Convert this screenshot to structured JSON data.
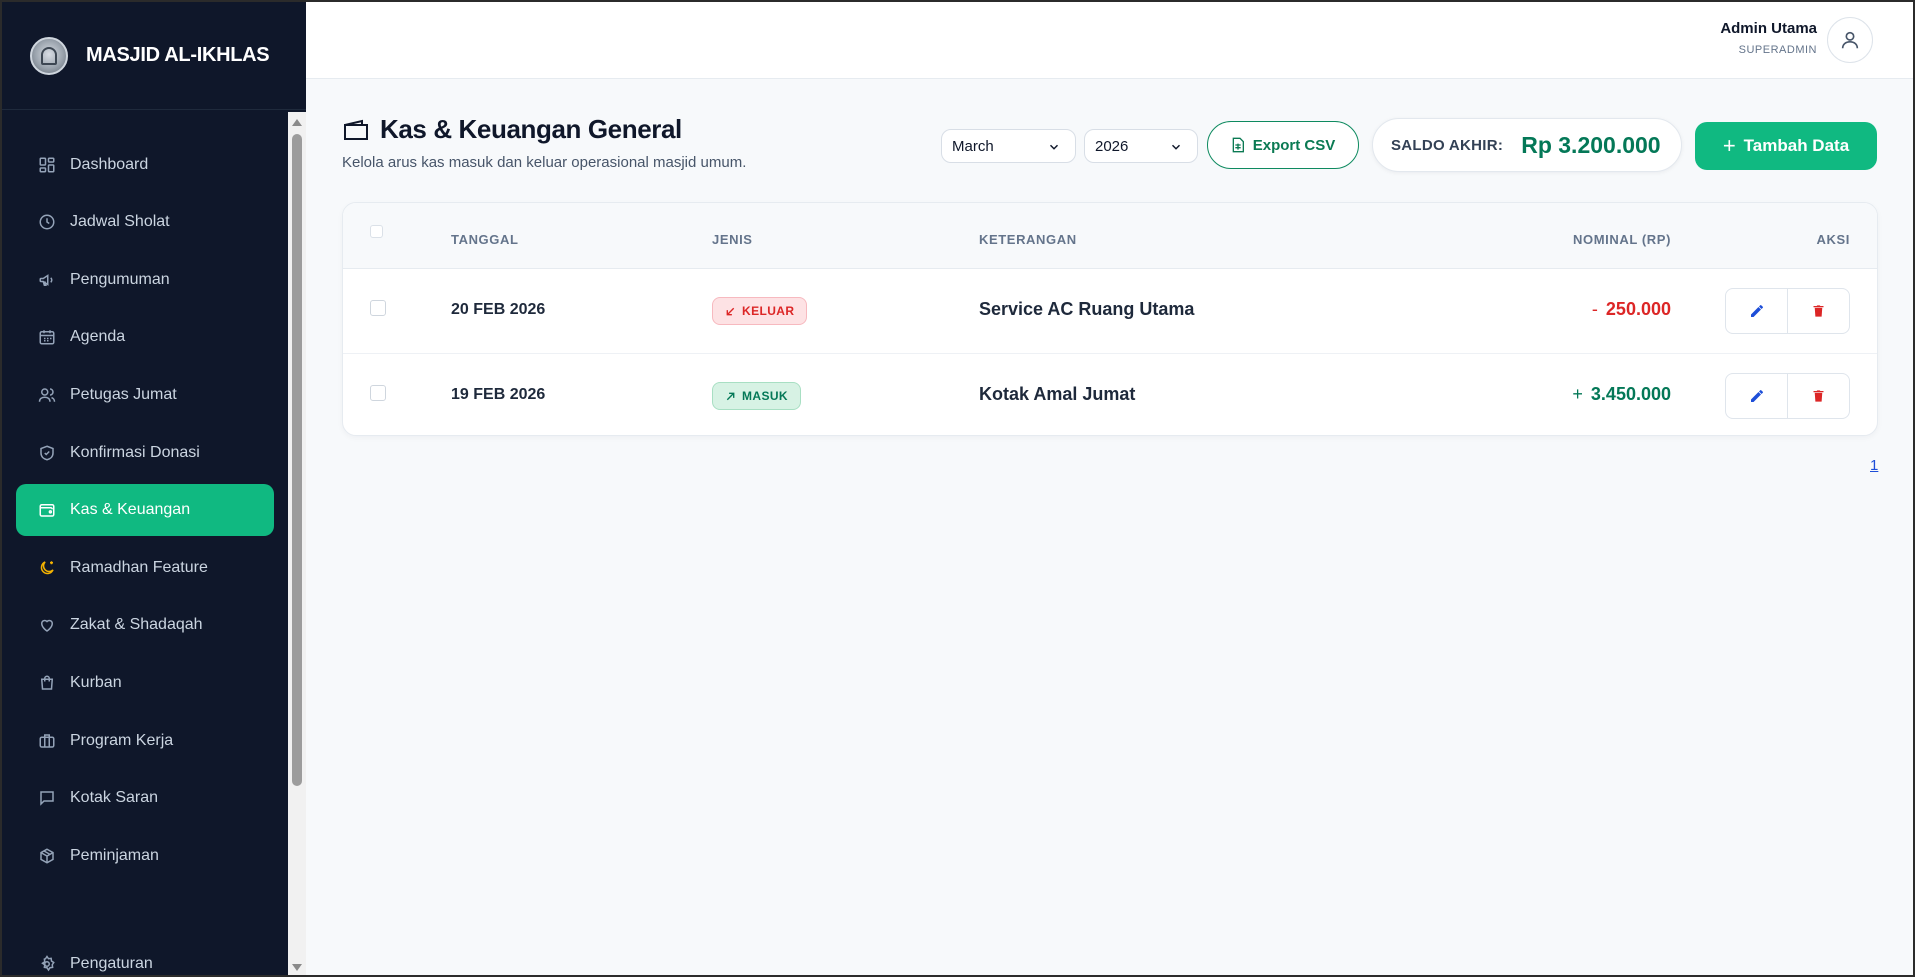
{
  "brand": {
    "title": "MASJID AL-IKHLAS"
  },
  "user": {
    "name": "Admin Utama",
    "role": "SUPERADMIN"
  },
  "sidebar": {
    "items": [
      {
        "label": "Dashboard",
        "icon": "grid-icon"
      },
      {
        "label": "Jadwal Sholat",
        "icon": "clock-icon"
      },
      {
        "label": "Pengumuman",
        "icon": "megaphone-icon"
      },
      {
        "label": "Agenda",
        "icon": "calendar-icon"
      },
      {
        "label": "Petugas Jumat",
        "icon": "users-icon"
      },
      {
        "label": "Konfirmasi Donasi",
        "icon": "shield-check-icon"
      },
      {
        "label": "Kas & Keuangan",
        "icon": "wallet-icon",
        "active": true
      },
      {
        "label": "Ramadhan Feature",
        "icon": "moon-star-icon"
      },
      {
        "label": "Zakat & Shadaqah",
        "icon": "heart-icon"
      },
      {
        "label": "Kurban",
        "icon": "shopping-bag-icon"
      },
      {
        "label": "Program Kerja",
        "icon": "briefcase-icon"
      },
      {
        "label": "Kotak Saran",
        "icon": "message-square-icon"
      },
      {
        "label": "Peminjaman",
        "icon": "box-icon"
      },
      {
        "label": "Pengaturan",
        "icon": "settings-icon"
      }
    ]
  },
  "page": {
    "title": "Kas & Keuangan General",
    "subtitle": "Kelola arus kas masuk dan keluar operasional masjid umum."
  },
  "filters": {
    "month": "March",
    "year": "2026"
  },
  "toolbar": {
    "export_label": "Export CSV",
    "add_label": "Tambah Data"
  },
  "saldo": {
    "label": "SALDO AKHIR:",
    "value": "Rp 3.200.000"
  },
  "table": {
    "headers": {
      "date": "TANGGAL",
      "type": "JENIS",
      "desc": "KETERANGAN",
      "amount": "NOMINAL (RP)",
      "actions": "AKSI"
    },
    "rows": [
      {
        "date": "20 FEB 2026",
        "type": "KELUAR",
        "direction": "out",
        "desc": "Service AC Ruang Utama",
        "sign": "-",
        "amount": "250.000"
      },
      {
        "date": "19 FEB 2026",
        "type": "MASUK",
        "direction": "in",
        "desc": "Kotak Amal Jumat",
        "sign": "+",
        "amount": "3.450.000"
      }
    ]
  },
  "pagination": {
    "current": "1"
  },
  "colors": {
    "sidebar_bg": "#0f172a",
    "accent": "#10b981",
    "danger": "#dc2626",
    "success_text": "#047857",
    "edit_icon": "#1d4ed8"
  }
}
